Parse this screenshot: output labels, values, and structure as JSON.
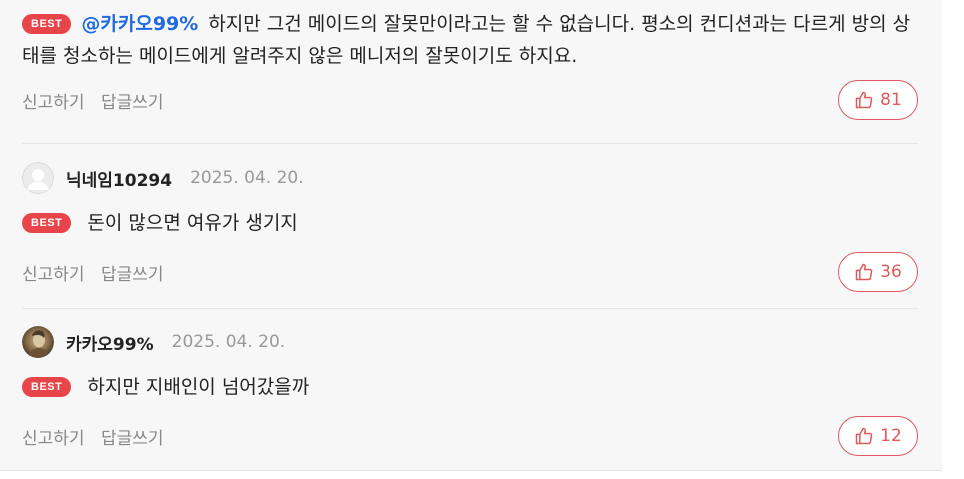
{
  "comments": [
    {
      "badge": "BEST",
      "mention": "@카카오99%",
      "text": "하지만 그건 메이드의 잘못만이라고는 할 수 없습니다. 평소의 컨디션과는 다르게 방의 상태를 청소하는 메이드에게 알려주지 않은 메니저의 잘못이기도 하지요.",
      "report_label": "신고하기",
      "reply_label": "답글쓰기",
      "likes": "81"
    },
    {
      "nickname": "닉네임10294",
      "date": "2025. 04. 20.",
      "avatar_icon": "default-avatar-icon",
      "badge": "BEST",
      "text": "돈이 많으면 여유가 생기지",
      "report_label": "신고하기",
      "reply_label": "답글쓰기",
      "likes": "36"
    },
    {
      "nickname": "카카오99%",
      "date": "2025. 04. 20.",
      "avatar_icon": "profile-photo-avatar",
      "badge": "BEST",
      "text": "하지만 지배인이 넘어갔을까",
      "report_label": "신고하기",
      "reply_label": "답글쓰기",
      "likes": "12"
    }
  ],
  "colors": {
    "accent_red": "#e8454a",
    "mention_blue": "#1f6ae0",
    "muted_text": "#888888",
    "panel_bg": "#f7f7f7"
  }
}
